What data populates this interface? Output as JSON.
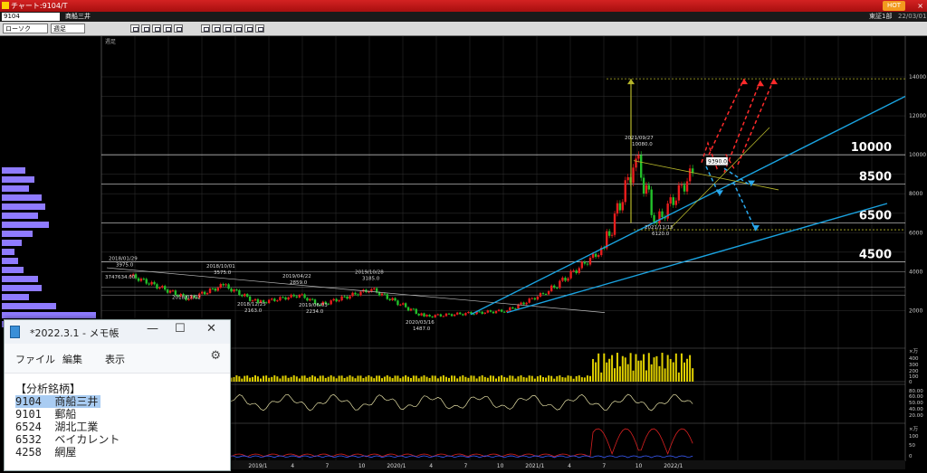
{
  "window": {
    "title": "チャート:9104/T",
    "hot_badge": "HOT",
    "close_glyph": "×"
  },
  "symbol_bar": {
    "code": "9104",
    "name": "商船三井",
    "market": "東証1部",
    "date": "22/03/01"
  },
  "toolbar": {
    "chart_type": "ローソク",
    "period": "週足"
  },
  "chart": {
    "corner_label": "週足",
    "price_levels": [
      {
        "label": "10000",
        "value": 10000
      },
      {
        "label": "8500",
        "value": 8500
      },
      {
        "label": "6500",
        "value": 6500
      },
      {
        "label": "4500",
        "value": 4500
      }
    ],
    "right_axis_ticks": [
      "14000",
      "12000",
      "10000",
      "8000",
      "6000",
      "4000",
      "2000"
    ],
    "date_ticks": [
      "2019/1",
      "4",
      "7",
      "10",
      "2020/1",
      "4",
      "7",
      "10",
      "2021/1",
      "4",
      "7",
      "10",
      "2022/1"
    ],
    "annotations": [
      {
        "date": "2018/01/29",
        "price": "3975.0"
      },
      {
        "date": "2018/10/01",
        "price": "3575.0"
      },
      {
        "date": "2018/07/02",
        "price": ""
      },
      {
        "date": "2018/12/25",
        "price": "2163.0"
      },
      {
        "date": "2019/04/22",
        "price": "2859.0"
      },
      {
        "date": "2019/06/03",
        "price": "2234.0"
      },
      {
        "date": "2019/10/28",
        "price": "3185.0"
      },
      {
        "date": "2020/03/16",
        "price": "1487.0"
      },
      {
        "date": "2021/09/27",
        "price": "10080.0"
      },
      {
        "date": "2021/11/15",
        "price": "6120.0"
      }
    ],
    "current_price": "9390.0",
    "small_value": "3747634.00",
    "volume_axis": [
      "×万",
      "400",
      "300",
      "200",
      "100",
      "0"
    ],
    "osc1_axis": [
      "80.00",
      "60.00",
      "50.00",
      "40.00",
      "20.00"
    ],
    "osc2_axis": [
      "×万",
      "100",
      "50",
      "0"
    ],
    "colors": {
      "grid": "#2b2b2b",
      "level": "#d6d6d6",
      "up": "#e81d1d",
      "down": "#22c02a",
      "trend": "#1aa3e0",
      "arrow_red": "#ff2a2a",
      "arrow_blue": "#2aa9ee",
      "target": "#b5b52a",
      "volume": "#e0d000",
      "profile": "#8f7bff"
    }
  },
  "notepad": {
    "title": "*2022.3.1 - メモ帳",
    "menu": [
      "ファイル",
      "編集",
      "表示"
    ],
    "lines": [
      {
        "code": "",
        "text": "【分析銘柄】",
        "hl": false
      },
      {
        "code": "9104",
        "text": "商船三井",
        "hl": true
      },
      {
        "code": "9101",
        "text": "郵船",
        "hl": false
      },
      {
        "code": "6524",
        "text": "湖北工業",
        "hl": false
      },
      {
        "code": "6532",
        "text": "ベイカレント",
        "hl": false
      },
      {
        "code": "4258",
        "text": "網屋",
        "hl": false
      }
    ]
  }
}
